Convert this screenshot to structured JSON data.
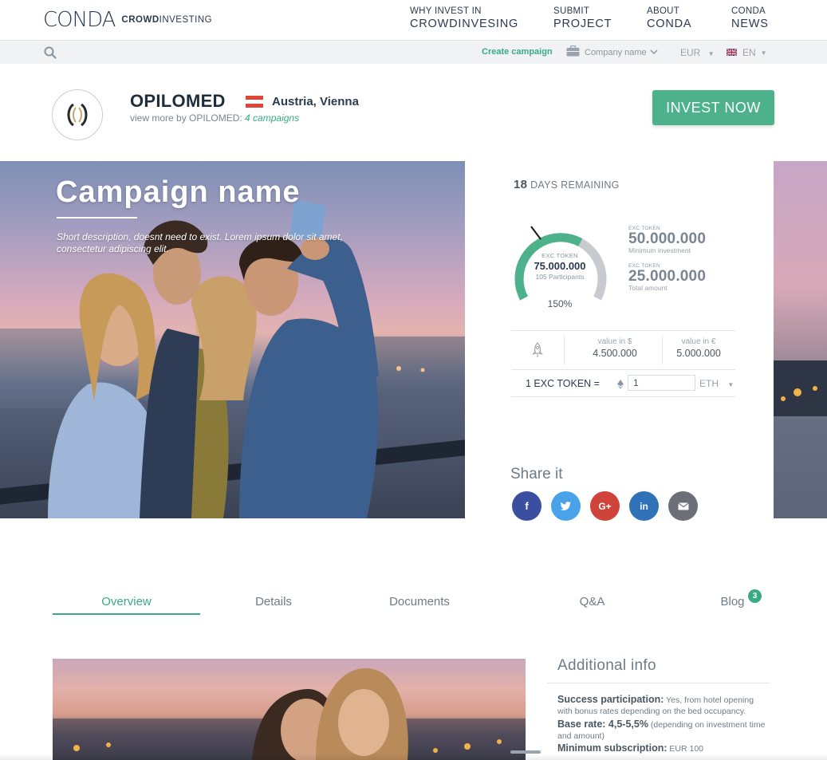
{
  "brand": {
    "logo_text": "CONDA",
    "logo_sub_bold": "CROWD",
    "logo_sub_rest": "INVESTING"
  },
  "nav": [
    {
      "small": "WHY INVEST IN",
      "big": "CROWDINVESING"
    },
    {
      "small": "SUBMIT",
      "big": "PROJECT"
    },
    {
      "small": "ABOUT",
      "big": "CONDA"
    },
    {
      "small": "CONDA",
      "big": "NEWS"
    }
  ],
  "subbar": {
    "create_label": "Create campaign",
    "company_label": "Company name",
    "currency": "EUR",
    "language": "EN"
  },
  "org": {
    "name": "OPILOMED",
    "location": "Austria, Vienna",
    "view_more_prefix": "view more by OPILOMED:",
    "campaigns_link": "4  campaigns"
  },
  "invest_button": "INVEST NOW",
  "hero": {
    "title": "Campaign name",
    "description": "Short description, doesnt need to exist. Lorem ipsum dolor sit amet, consectetur adipiscing elit."
  },
  "stats": {
    "days_number": "18",
    "days_label": "DAYS REMAINING",
    "gauge": {
      "label": "EXC TOKEN",
      "value": "75.000.000",
      "participants": "105 Participants",
      "percent": "150%",
      "fill_fraction": 0.62
    },
    "min_investment": {
      "label": "EXC TOKEN",
      "value": "50.000.000",
      "sub": "Minimum investment"
    },
    "total_amount": {
      "label": "EXC TOKEN",
      "value": "25.000.000",
      "sub": "Total amount"
    },
    "value_usd_label": "value in $",
    "value_usd": "4.500.000",
    "value_eur_label": "value in €",
    "value_eur": "5.000.000",
    "conversion_label": "1 EXC TOKEN =",
    "conversion_value": "1",
    "conversion_currency": "ETH"
  },
  "share": {
    "title": "Share it",
    "networks": [
      "facebook",
      "twitter",
      "google-plus",
      "linkedin",
      "email"
    ]
  },
  "tabs": [
    {
      "label": "Overview"
    },
    {
      "label": "Details"
    },
    {
      "label": "Documents"
    },
    {
      "label": "Q&A"
    },
    {
      "label": "Blog"
    }
  ],
  "blog_badge": "3",
  "additional_info": {
    "title": "Additional info",
    "items": [
      {
        "label": "Success participation:",
        "text": "Yes, from hotel opening with bonus rates depending on the bed occupancy."
      },
      {
        "label": "Base rate: 4,5-5,5%",
        "text": "(depending on investment time and amount)"
      },
      {
        "label": "Minimum subscription:",
        "text": "EUR 100"
      }
    ]
  },
  "colors": {
    "accent": "#4db28c",
    "facebook": "#3b5998",
    "twitter": "#4aa3e8",
    "google": "#d0433a",
    "linkedin": "#2f72b8",
    "email": "#6d6f78"
  }
}
